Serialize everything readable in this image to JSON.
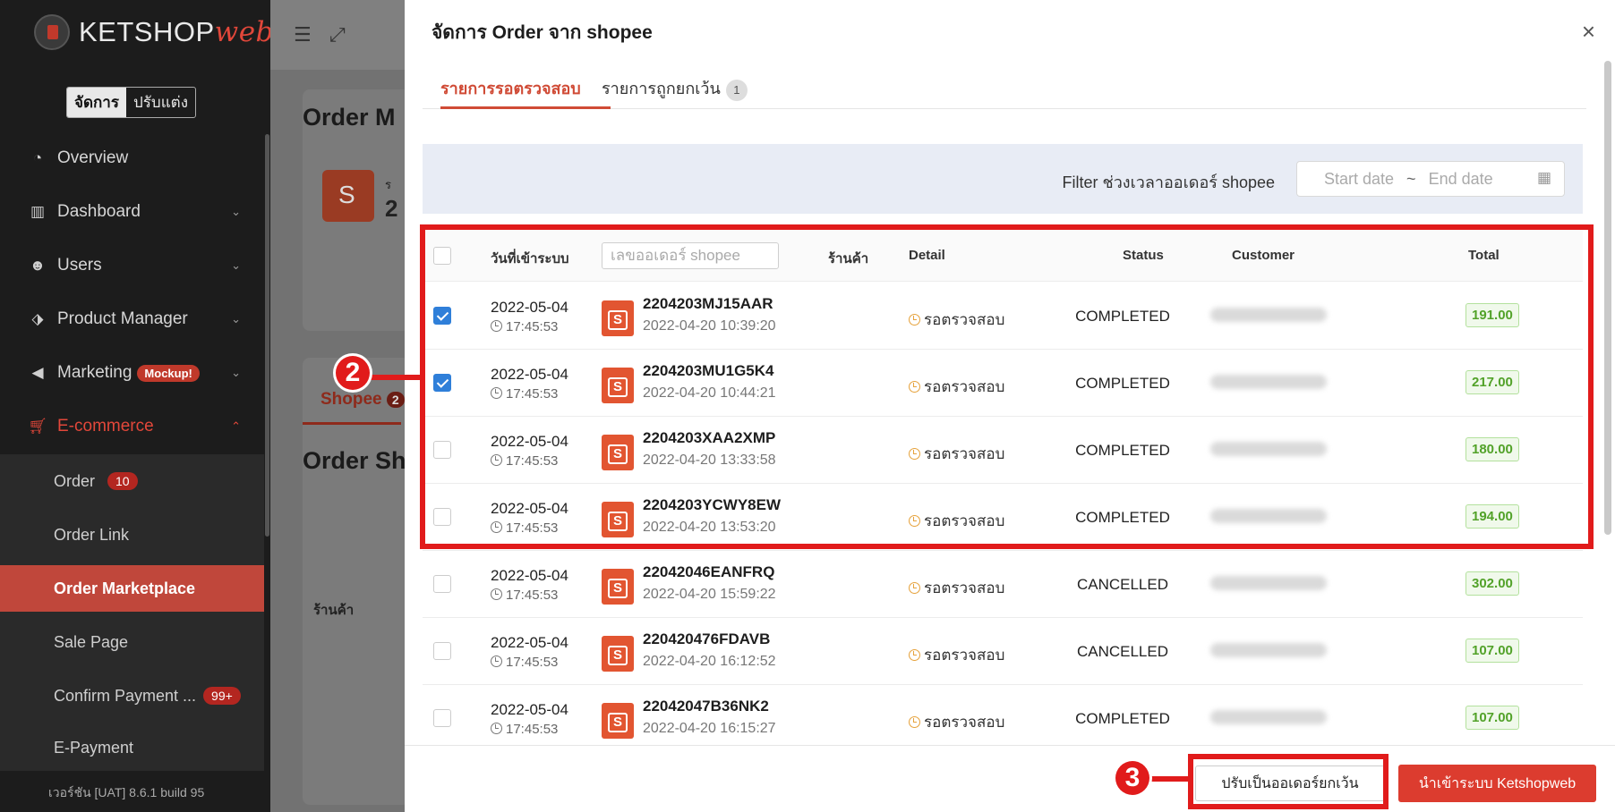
{
  "sidebar": {
    "brand_main": "KETSHOP",
    "brand_accent": "web",
    "mode_active": "จัดการ",
    "mode_inactive": "ปรับแต่ง",
    "nav": {
      "overview": "Overview",
      "dashboard": "Dashboard",
      "users": "Users",
      "product_manager": "Product Manager",
      "marketing": "Marketing",
      "marketing_badge": "Mockup!",
      "ecommerce": "E-commerce"
    },
    "sub": {
      "order": "Order",
      "order_count": "10",
      "order_link": "Order Link",
      "order_marketplace": "Order Marketplace",
      "sale_page": "Sale Page",
      "confirm_payment": "Confirm Payment ...",
      "confirm_count": "99+",
      "e_payment": "E-Payment"
    },
    "version": "เวอร์ชัน [UAT] 8.6.1 build 95"
  },
  "background": {
    "title_1": "Order M",
    "store_letter": "S",
    "line_char": "ร",
    "count_digit": "2",
    "tab": "Shopee",
    "tab_count": "2",
    "title_2": "Order Sh",
    "col": "ร้านค้า"
  },
  "drawer": {
    "title": "จัดการ Order จาก shopee",
    "close": "×",
    "tabs": {
      "pending": "รายการรอตรวจสอบ",
      "excluded": "รายการถูกยกเว้น",
      "excluded_count": "1"
    },
    "filter": {
      "label": "Filter ช่วงเวลาออเดอร์ shopee",
      "start_placeholder": "Start date",
      "separator": "~",
      "end_placeholder": "End date"
    },
    "table": {
      "headers": {
        "date": "วันที่เข้าระบบ",
        "search_placeholder": "เลขออเดอร์ shopee",
        "store": "ร้านค้า",
        "detail": "Detail",
        "status": "Status",
        "customer": "Customer",
        "total": "Total"
      },
      "rows": [
        {
          "checked": true,
          "date": "2022-05-04",
          "time": "17:45:53",
          "order_id": "2204203MJ15AAR",
          "order_date": "2022-04-20 10:39:20",
          "detail": "รอตรวจสอบ",
          "status": "COMPLETED",
          "total": "191.00"
        },
        {
          "checked": true,
          "date": "2022-05-04",
          "time": "17:45:53",
          "order_id": "2204203MU1G5K4",
          "order_date": "2022-04-20 10:44:21",
          "detail": "รอตรวจสอบ",
          "status": "COMPLETED",
          "total": "217.00"
        },
        {
          "checked": false,
          "date": "2022-05-04",
          "time": "17:45:53",
          "order_id": "2204203XAA2XMP",
          "order_date": "2022-04-20 13:33:58",
          "detail": "รอตรวจสอบ",
          "status": "COMPLETED",
          "total": "180.00"
        },
        {
          "checked": false,
          "date": "2022-05-04",
          "time": "17:45:53",
          "order_id": "2204203YCWY8EW",
          "order_date": "2022-04-20 13:53:20",
          "detail": "รอตรวจสอบ",
          "status": "COMPLETED",
          "total": "194.00"
        },
        {
          "checked": false,
          "date": "2022-05-04",
          "time": "17:45:53",
          "order_id": "22042046EANFRQ",
          "order_date": "2022-04-20 15:59:22",
          "detail": "รอตรวจสอบ",
          "status": "CANCELLED",
          "total": "302.00"
        },
        {
          "checked": false,
          "date": "2022-05-04",
          "time": "17:45:53",
          "order_id": "220420476FDAVB",
          "order_date": "2022-04-20 16:12:52",
          "detail": "รอตรวจสอบ",
          "status": "CANCELLED",
          "total": "107.00"
        },
        {
          "checked": false,
          "date": "2022-05-04",
          "time": "17:45:53",
          "order_id": "22042047B36NK2",
          "order_date": "2022-04-20 16:15:27",
          "detail": "รอตรวจสอบ",
          "status": "COMPLETED",
          "total": "107.00"
        }
      ],
      "shopee_icon_letter": "S"
    },
    "footer": {
      "exception_btn": "ปรับเป็นออเดอร์ยกเว้น",
      "import_btn": "นำเข้าระบบ Ketshopweb"
    }
  },
  "annotations": {
    "step_2": "2",
    "step_3": "3"
  },
  "colors": {
    "accent": "#dc3c2f",
    "annotation": "#e11b1b",
    "checkbox": "#2f7fd9",
    "total_green": "#52a229"
  }
}
